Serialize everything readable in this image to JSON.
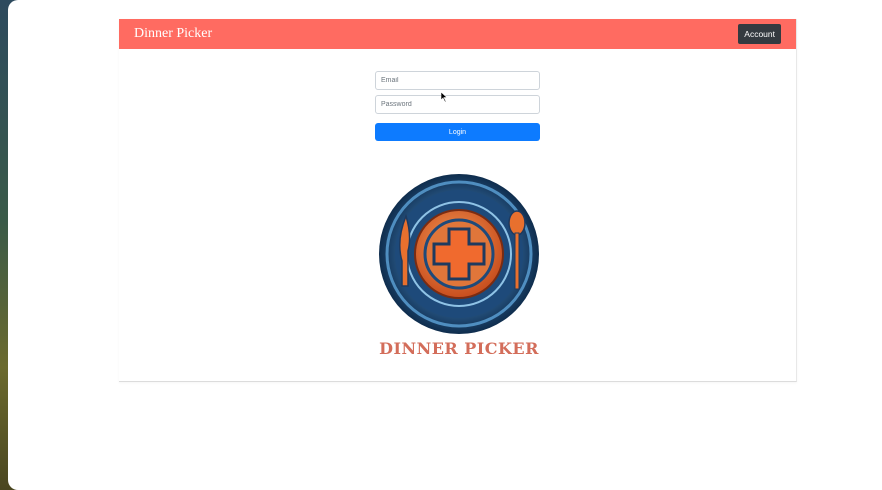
{
  "navbar": {
    "brand": "Dinner Picker",
    "account_label": "Account",
    "color": "#ff6b61"
  },
  "login_form": {
    "email_placeholder": "Email",
    "password_placeholder": "Password",
    "login_label": "Login",
    "button_color": "#0d7bff"
  },
  "logo": {
    "text": "DINNER PICKER",
    "icon": "plate-plus-fork-spoon-logo"
  }
}
